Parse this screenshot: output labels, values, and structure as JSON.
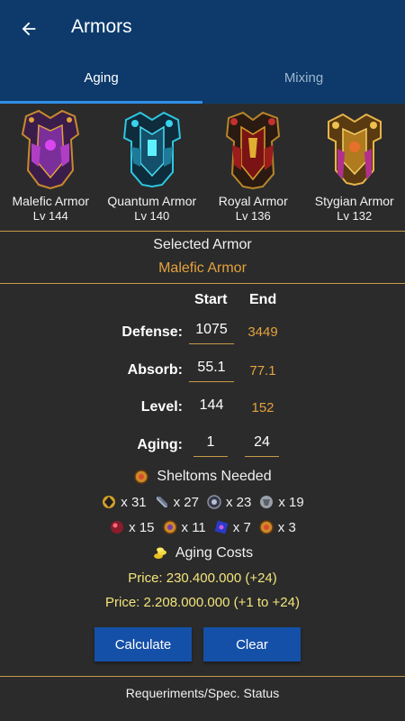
{
  "app": {
    "title": "Armors"
  },
  "tabs": [
    {
      "label": "Aging",
      "active": true
    },
    {
      "label": "Mixing",
      "active": false
    }
  ],
  "armors": [
    {
      "name": "Malefic Armor",
      "level": "Lv 144",
      "icon": "malefic-armor-icon"
    },
    {
      "name": "Quantum Armor",
      "level": "Lv 140",
      "icon": "quantum-armor-icon"
    },
    {
      "name": "Royal Armor",
      "level": "Lv 136",
      "icon": "royal-armor-icon"
    },
    {
      "name": "Stygian Armor",
      "level": "Lv 132",
      "icon": "stygian-armor-icon"
    }
  ],
  "selected": {
    "title": "Selected Armor",
    "name": "Malefic Armor"
  },
  "columns": {
    "start": "Start",
    "end": "End"
  },
  "stats": {
    "defense": {
      "label": "Defense:",
      "start": "1075",
      "end": "3449"
    },
    "absorb": {
      "label": "Absorb:",
      "start": "55.1",
      "end": "77.1"
    },
    "level": {
      "label": "Level:",
      "start": "144",
      "end": "152"
    },
    "aging": {
      "label": "Aging:",
      "start": "1",
      "end": "24"
    }
  },
  "sheltoms": {
    "title": "Sheltoms Needed",
    "row1": [
      {
        "icon": "sheltom-1-icon",
        "count": "x 31"
      },
      {
        "icon": "sheltom-2-icon",
        "count": "x 27"
      },
      {
        "icon": "sheltom-3-icon",
        "count": "x 23"
      },
      {
        "icon": "sheltom-4-icon",
        "count": "x 19"
      }
    ],
    "row2": [
      {
        "icon": "sheltom-5-icon",
        "count": "x 15"
      },
      {
        "icon": "sheltom-6-icon",
        "count": "x 11"
      },
      {
        "icon": "sheltom-7-icon",
        "count": "x 7"
      },
      {
        "icon": "sheltom-8-icon",
        "count": "x 3"
      }
    ]
  },
  "costs": {
    "title": "Aging Costs",
    "price1": "Price:  230.400.000 (+24)",
    "price2": "Price:  2.208.000.000 (+1 to +24)"
  },
  "buttons": {
    "calculate": "Calculate",
    "clear": "Clear"
  },
  "footer": {
    "requirements": "Requeriments/Spec. Status"
  },
  "colors": {
    "appbar": "#0d3a6b",
    "accent": "#e4a23c",
    "divider": "#c69a48",
    "button": "#1550a8",
    "price": "#f3e57a",
    "background": "#2b2b2b"
  }
}
